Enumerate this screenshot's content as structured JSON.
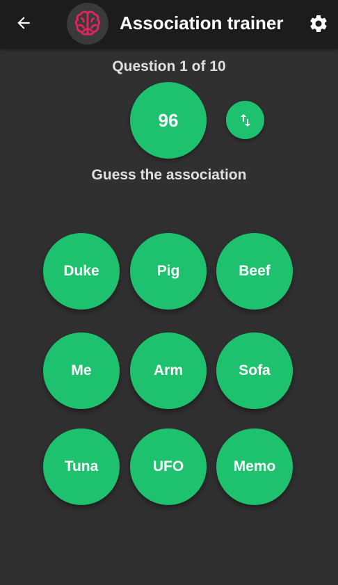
{
  "appbar": {
    "title": "Association trainer",
    "back_icon": "arrow-left-icon",
    "logo_icon": "brain-icon",
    "settings_icon": "gear-icon"
  },
  "quiz": {
    "counter": "Question 1 of 10",
    "number": "96",
    "swap_icon": "swap-vertical-icon",
    "prompt": "Guess the association"
  },
  "answers": [
    "Duke",
    "Pig",
    "Beef",
    "Me",
    "Arm",
    "Sofa",
    "Tuna",
    "UFO",
    "Memo"
  ],
  "colors": {
    "accent": "#1ec26e",
    "background": "#303030",
    "appbar": "#1c1c1c",
    "logo": "#e0245e"
  }
}
